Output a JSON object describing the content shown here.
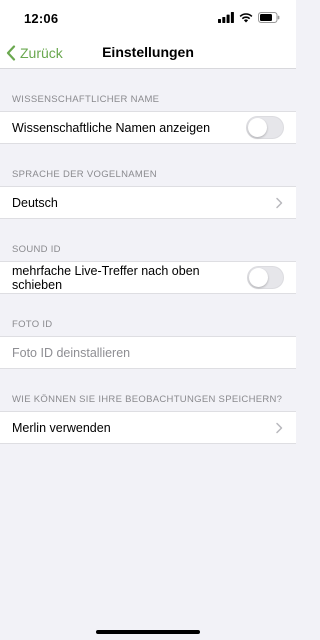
{
  "status_bar": {
    "time": "12:06"
  },
  "nav": {
    "back_label": "Zurück",
    "title": "Einstellungen"
  },
  "sections": [
    {
      "header": "WISSENSCHAFTLICHER NAME",
      "row_label": "Wissenschaftliche Namen anzeigen",
      "control": "toggle",
      "toggle_on": false
    },
    {
      "header": "SPRACHE DER VOGELNAMEN",
      "row_label": "Deutsch",
      "control": "chevron"
    },
    {
      "header": "SOUND ID",
      "row_label": "mehrfache Live-Treffer nach oben schieben",
      "control": "toggle",
      "toggle_on": false
    },
    {
      "header": "FOTO ID",
      "row_label": "Foto ID deinstallieren",
      "control": "none",
      "disabled": true
    },
    {
      "header": "WIE KÖNNEN SIE IHRE BEOBACHTUNGEN SPEICHERN?",
      "row_label": "Merlin verwenden",
      "control": "chevron"
    }
  ],
  "colors": {
    "accent": "#6aa84f",
    "background": "#f2f2f7",
    "header_text": "#8a8a8e"
  },
  "icons": [
    "signal-icon",
    "wifi-icon",
    "battery-icon",
    "back-chevron-icon",
    "chevron-right-icon"
  ]
}
